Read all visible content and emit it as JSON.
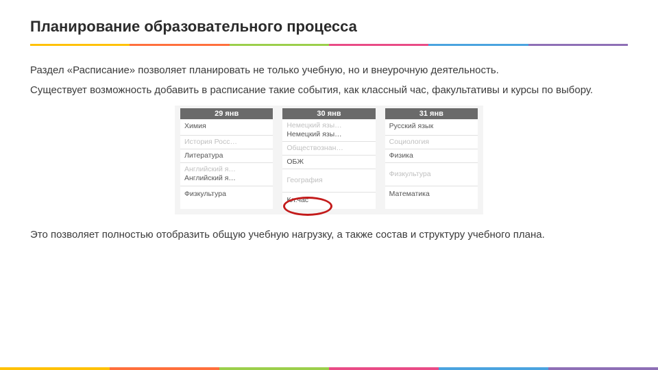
{
  "colors": {
    "c1": "#ffc107",
    "c2": "#ff6f3c",
    "c3": "#9bcf4b",
    "c4": "#e94b86",
    "c5": "#4aa3df",
    "c6": "#8e6fb6"
  },
  "title": "Планирование образовательного процесса",
  "intro_p1": "Раздел «Расписание» позволяет планировать не только учебную, но и внеурочную деятельность.",
  "intro_p2": "Существует возможность добавить в расписание такие события, как классный час, факультативы и курсы по выбору.",
  "outro": "Это позволяет полностью отобразить общую учебную нагрузку, а также состав и структуру учебного плана.",
  "schedule": {
    "days": [
      {
        "date": "29 янв",
        "rows": [
          {
            "dark": "Химия",
            "light": ""
          },
          {
            "dark": "",
            "light": "История Росс…"
          },
          {
            "dark": "Литература",
            "light": ""
          },
          {
            "dark": "Английский я…",
            "light": "Английский я…"
          },
          {
            "dark": "Физкультура",
            "light": ""
          }
        ]
      },
      {
        "date": "30 янв",
        "rows": [
          {
            "dark": "Немецкий язы…",
            "light": "Немецкий язы…"
          },
          {
            "dark": "",
            "light": "Обществознан…"
          },
          {
            "dark": "ОБЖ",
            "light": ""
          },
          {
            "dark": "",
            "light": "География"
          },
          {
            "dark": "Кл.час",
            "light": ""
          }
        ]
      },
      {
        "date": "31 янв",
        "rows": [
          {
            "dark": "Русский язык",
            "light": ""
          },
          {
            "dark": "",
            "light": "Социология"
          },
          {
            "dark": "Физика",
            "light": ""
          },
          {
            "dark": "",
            "light": "Физкультура"
          },
          {
            "dark": "Математика",
            "light": ""
          }
        ]
      }
    ]
  }
}
